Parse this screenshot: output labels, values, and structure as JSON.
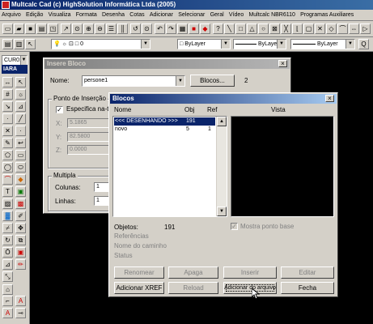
{
  "app": {
    "title": "Multcalc Cad (c) HighSolution Informática Ltda (2005)"
  },
  "menu": [
    "Arquivo",
    "Edição",
    "Visualiza",
    "Formata",
    "Desenha",
    "Cotas",
    "Adicionar",
    "Selecionar",
    "Geral",
    "Vídeo",
    "Multcalc NBR6110",
    "Programas Auxiliares"
  ],
  "toolbar": {
    "layer_value": "0",
    "color_value": "ByLayer",
    "linetype_value": "ByLayer",
    "lineweight_value": "ByLayer"
  },
  "lefttb": {
    "combo_value": "CUR01",
    "label": "IARA"
  },
  "insere": {
    "title": "Insere Bloco",
    "nome_label": "Nome:",
    "nome_value": "persone1",
    "blocos_btn": "Blocos...",
    "count": "2",
    "ponto_group": "Ponto de Inserção",
    "especifica_label": "Especifica na-te",
    "x_label": "X:",
    "x_value": "5.1865",
    "y_label": "Y:",
    "y_value": "82.5800",
    "z_label": "Z:",
    "z_value": "0.0000",
    "multipla_group": "Multipla",
    "colunas_label": "Colunas:",
    "colunas_value": "1",
    "linhas_label": "Linhas:",
    "linhas_value": "1"
  },
  "blocos": {
    "title": "Blocos",
    "col_nome": "Nome",
    "col_obj": "Obj",
    "col_ref": "Ref",
    "col_vista": "Vista",
    "rows": [
      {
        "nome": "<<< DESENHANDO >>>",
        "obj": "191",
        "ref": ""
      },
      {
        "nome": "novo",
        "obj": "5",
        "ref": "1"
      }
    ],
    "objetos_label": "Objetos:",
    "objetos_value": "191",
    "referencias_label": "Referências",
    "nome_caminho_label": "Nome do caminho",
    "status_label": "Status",
    "mostra_label": "Mostra ponto base",
    "btn_renomear": "Renomear",
    "btn_apaga": "Apaga",
    "btn_inserir": "Inserir",
    "btn_editar": "Editar",
    "btn_xref": "Adicionar XREF",
    "btn_reload": "Reload",
    "btn_adicionar_arquivo": "Adicionar do arquivo",
    "btn_fecha": "Fecha"
  }
}
